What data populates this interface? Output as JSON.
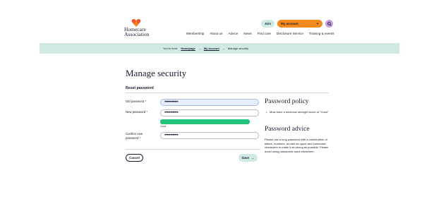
{
  "header": {
    "logo_line1": "Homecare",
    "logo_line2": "Association",
    "join_label": "Join",
    "account_label": "My account",
    "nav": [
      "Membership",
      "About us",
      "Advice",
      "News",
      "Find care",
      "Disclosure Service",
      "Training & events"
    ]
  },
  "breadcrumb": {
    "prefix": "You're here:",
    "items": [
      "Homepage",
      "My account",
      "Manage security"
    ]
  },
  "main": {
    "title": "Manage security",
    "section": "Reset password",
    "old_password_label": "Old password *",
    "old_password_value": "••••••••••••",
    "new_password_label": "New password *",
    "new_password_value": "••••••••••••",
    "strength_label": "Good",
    "strength_fraction": 0.91,
    "confirm_label_line1": "Confirm new",
    "confirm_label_line2": "password *",
    "confirm_value": "••••••••••••",
    "cancel_label": "Cancel",
    "save_label": "Save"
  },
  "side": {
    "policy_title": "Password policy",
    "policy_items": [
      "Must have a minimum strength score of \"Good\""
    ],
    "advice_title": "Password advice",
    "advice_text": "Please use a long password with a combination of letters, numbers, as well as upper and lowercase characters to make it as strong as possible. Please avoid using passwords used elsewhere."
  },
  "colors": {
    "accent_orange": "#f28a1c",
    "accent_teal": "#cfe9e5",
    "strength_green": "#22c27a",
    "search_purple": "#c8a0e0"
  }
}
